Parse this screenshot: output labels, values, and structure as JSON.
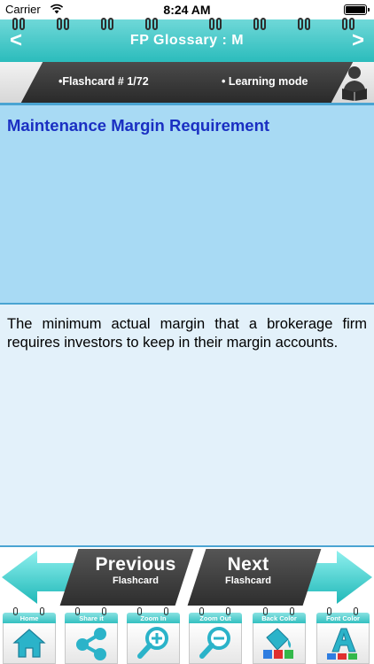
{
  "status": {
    "carrier": "Carrier",
    "time": "8:24 AM"
  },
  "header": {
    "title": "FP Glossary : M",
    "back_glyph": "<",
    "forward_glyph": ">"
  },
  "info": {
    "flashcard": "•Flashcard #  1/72",
    "mode": "• Learning mode"
  },
  "card": {
    "term": "Maintenance Margin Requirement",
    "definition": "The minimum actual margin that a brokerage firm requires investors to keep in their margin accounts."
  },
  "navigation": {
    "previous_main": "Previous",
    "previous_sub": "Flashcard",
    "next_main": "Next",
    "next_sub": "Flashcard"
  },
  "toolbar": [
    {
      "label": "Home",
      "icon": "home-icon"
    },
    {
      "label": "Share it",
      "icon": "share-icon"
    },
    {
      "label": "Zoom In",
      "icon": "zoom-in-icon"
    },
    {
      "label": "Zoom Out",
      "icon": "zoom-out-icon"
    },
    {
      "label": "Back Color",
      "icon": "paint-bucket-icon"
    },
    {
      "label": "Font Color",
      "icon": "font-color-icon"
    }
  ],
  "colors": {
    "teal": "#2bbcbc",
    "term_panel": "#a8daf4",
    "definition_panel": "#e3f1fa",
    "term_text": "#1a2fc2"
  }
}
